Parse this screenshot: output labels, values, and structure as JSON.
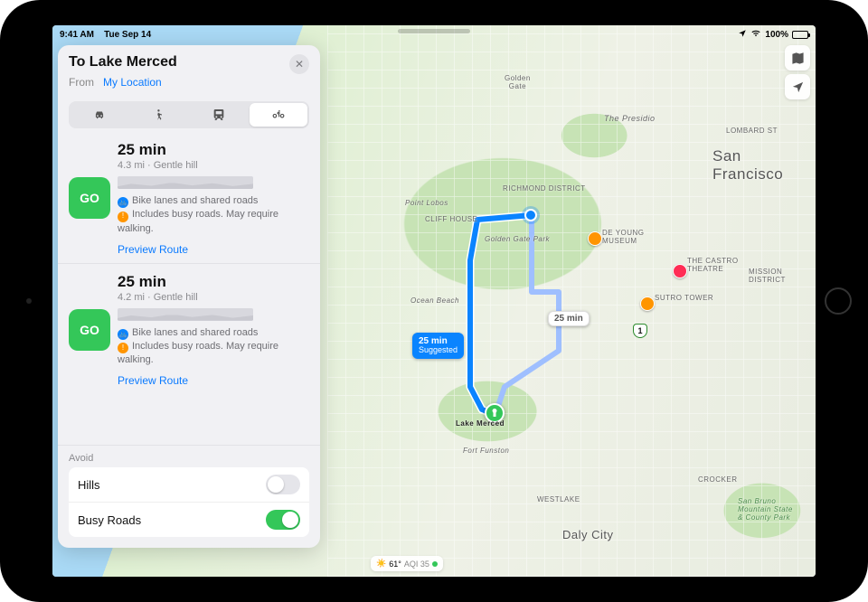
{
  "status": {
    "time": "9:41 AM",
    "date": "Tue Sep 14",
    "battery": "100%"
  },
  "card": {
    "title": "To Lake Merced",
    "from_label": "From",
    "from_value": "My Location",
    "modes": [
      "drive",
      "walk",
      "transit",
      "cycle"
    ],
    "active_mode": "cycle"
  },
  "routes": [
    {
      "duration": "25 min",
      "sub": "4.3 mi · Gentle hill",
      "adv1": "Bike lanes and shared roads",
      "adv2": "Includes busy roads. May require walking.",
      "go": "GO",
      "preview": "Preview Route"
    },
    {
      "duration": "25 min",
      "sub": "4.2 mi · Gentle hill",
      "adv1": "Bike lanes and shared roads",
      "adv2": "Includes busy roads. May require walking.",
      "go": "GO",
      "preview": "Preview Route"
    }
  ],
  "avoid": {
    "title": "Avoid",
    "options": [
      {
        "label": "Hills",
        "on": false
      },
      {
        "label": "Busy Roads",
        "on": true
      }
    ]
  },
  "map": {
    "labels": {
      "golden_gate": "Golden\nGate",
      "presidio": "The Presidio",
      "lombard": "LOMBARD ST",
      "sf": "San Francisco",
      "richmond": "RICHMOND DISTRICT",
      "point_lobos": "Point Lobos",
      "cliff_house": "CLIFF HOUSE",
      "ggpark": "Golden Gate Park",
      "deyoung": "DE YOUNG\nMUSEUM",
      "castro": "THE CASTRO\nTHEATRE",
      "sutro": "SUTRO TOWER",
      "mission": "MISSION\nDISTRICT",
      "ocean_beach": "Ocean Beach",
      "lake_merced": "Lake Merced",
      "fort_funston": "Fort Funston",
      "westlake": "WESTLAKE",
      "crocker": "CROCKER",
      "san_bruno": "San Bruno\nMountain State\n& County Park",
      "daly": "Daly City"
    },
    "route_badge": {
      "line1": "25 min",
      "line2": "Suggested"
    },
    "alt_badge": "25 min",
    "weather": {
      "temp": "61°",
      "aqi": "AQI 35"
    }
  }
}
